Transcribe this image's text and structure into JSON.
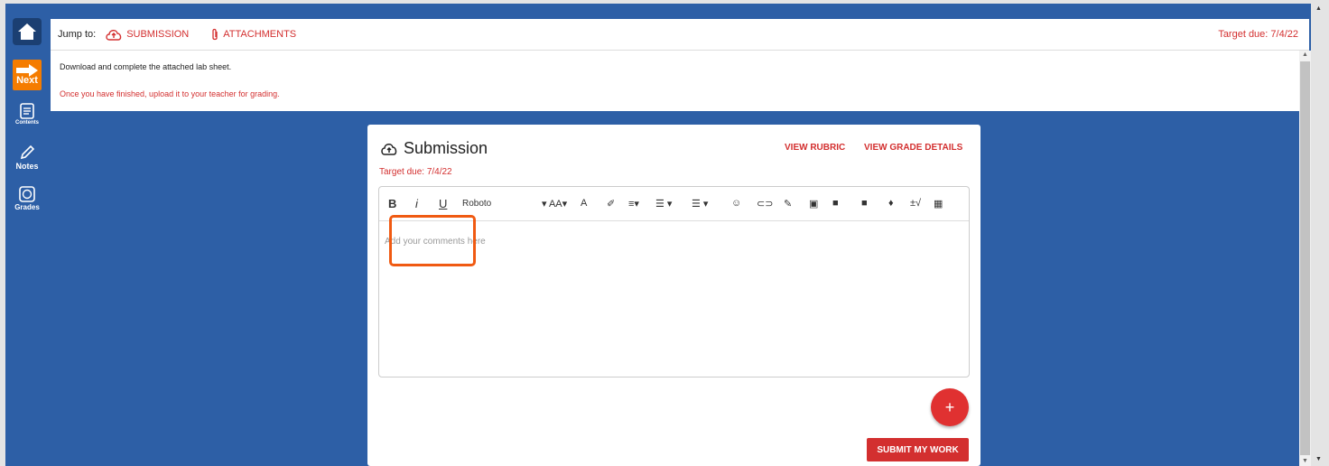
{
  "sidebar": {
    "items": [
      {
        "label": ""
      },
      {
        "label": "Next"
      },
      {
        "label": "Contents"
      },
      {
        "label": "Notes"
      },
      {
        "label": "Grades"
      }
    ]
  },
  "topbar": {
    "jump_label": "Jump to:",
    "submission_link": "SUBMISSION",
    "attachments_link": "ATTACHMENTS",
    "target_due": "Target due: 7/4/22"
  },
  "instructions": {
    "line1": "Download and complete the attached lab sheet.",
    "line2": "Once you have finished, upload it to your teacher for grading."
  },
  "card": {
    "title": "Submission",
    "target_due": "Target due: 7/4/22",
    "view_rubric": "VIEW RUBRIC",
    "view_grade_details": "VIEW GRADE DETAILS",
    "editor": {
      "font_name": "Roboto",
      "placeholder": "Add your comments here"
    },
    "add_button": "+",
    "submit_label": "SUBMIT MY WORK"
  },
  "colors": {
    "accent": "#d32f2f",
    "sidebar": "#2d5fa6",
    "next": "#f57c00",
    "highlight": "#f05a12"
  }
}
